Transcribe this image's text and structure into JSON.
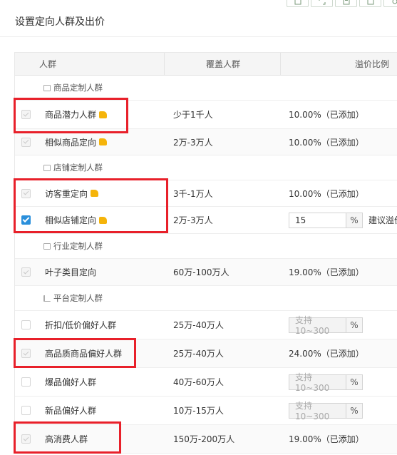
{
  "page": {
    "title": "设置定向人群及出价"
  },
  "toolbar_icons": [
    "export-icon",
    "expand-icon",
    "save-icon",
    "calendar-icon",
    "settings-icon"
  ],
  "table": {
    "headers": {
      "crowd": "人群",
      "coverage": "覆盖人群",
      "premium": "溢价比例"
    },
    "groups": [
      {
        "label": "商品定制人群",
        "icon": "box-icon",
        "items": [
          {
            "name": "商品潜力人群",
            "hot": true,
            "coverage": "少于1千人",
            "premium": "10.00%（已添加）",
            "state": "disabled"
          },
          {
            "name": "相似商品定向",
            "hot": true,
            "coverage": "2万-3万人",
            "premium": "10.00%（已添加）",
            "state": "disabled"
          }
        ]
      },
      {
        "label": "店铺定制人群",
        "icon": "store-icon",
        "items": [
          {
            "name": "访客重定向",
            "hot": true,
            "coverage": "3千-1万人",
            "premium": "10.00%（已添加）",
            "state": "disabled"
          },
          {
            "name": "相似店铺定向",
            "hot": true,
            "coverage": "2万-3万人",
            "input": "15",
            "unit": "%",
            "hint": "建议溢价",
            "state": "checked"
          }
        ]
      },
      {
        "label": "行业定制人群",
        "icon": "briefcase-icon",
        "items": [
          {
            "name": "叶子类目定向",
            "hot": false,
            "coverage": "60万-100万人",
            "premium": "19.00%（已添加）",
            "state": "disabled"
          }
        ]
      },
      {
        "label": "平台定制人群",
        "icon": "bar-chart-icon",
        "items": [
          {
            "name": "折扣/低价偏好人群",
            "hot": false,
            "coverage": "25万-40万人",
            "input_placeholder": "支持10~300",
            "unit": "%",
            "state": "empty"
          },
          {
            "name": "高品质商品偏好人群",
            "hot": false,
            "coverage": "25万-40万人",
            "premium": "24.00%（已添加）",
            "state": "disabled"
          },
          {
            "name": "爆品偏好人群",
            "hot": false,
            "coverage": "40万-60万人",
            "input_placeholder": "支持10~300",
            "unit": "%",
            "state": "empty"
          },
          {
            "name": "新品偏好人群",
            "hot": false,
            "coverage": "10万-15万人",
            "input_placeholder": "支持10~300",
            "unit": "%",
            "state": "empty"
          },
          {
            "name": "高消费人群",
            "hot": false,
            "coverage": "150万-200万人",
            "premium": "19.00%（已添加）",
            "state": "disabled"
          }
        ]
      }
    ]
  },
  "annotation_color": "#e8202a"
}
